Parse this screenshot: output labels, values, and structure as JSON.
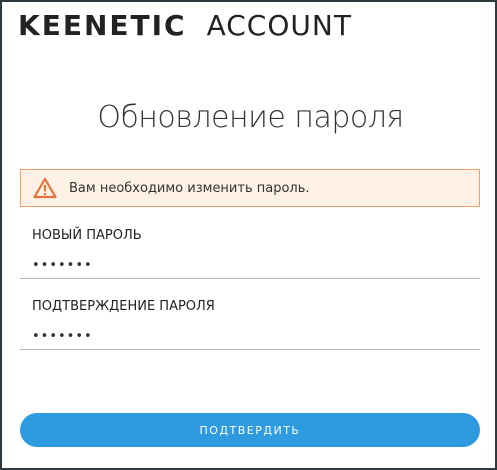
{
  "header": {
    "brand": "KEENETIC",
    "product": "ACCOUNT"
  },
  "page": {
    "title": "Обновление пароля"
  },
  "alert": {
    "icon": "warning-icon",
    "message": "Вам необходимо изменить пароль.",
    "colors": {
      "border": "#f0a060",
      "background": "#fdf0e4",
      "icon": "#e8733a"
    }
  },
  "form": {
    "new_password": {
      "label": "НОВЫЙ ПАРОЛЬ",
      "value": "•••••••"
    },
    "confirm_password": {
      "label": "ПОДТВЕРЖДЕНИЕ ПАРОЛЯ",
      "value": "•••••••"
    },
    "submit_label": "ПОДТВЕРДИТЬ"
  },
  "colors": {
    "accent": "#2e9ae0",
    "text": "#222222"
  }
}
